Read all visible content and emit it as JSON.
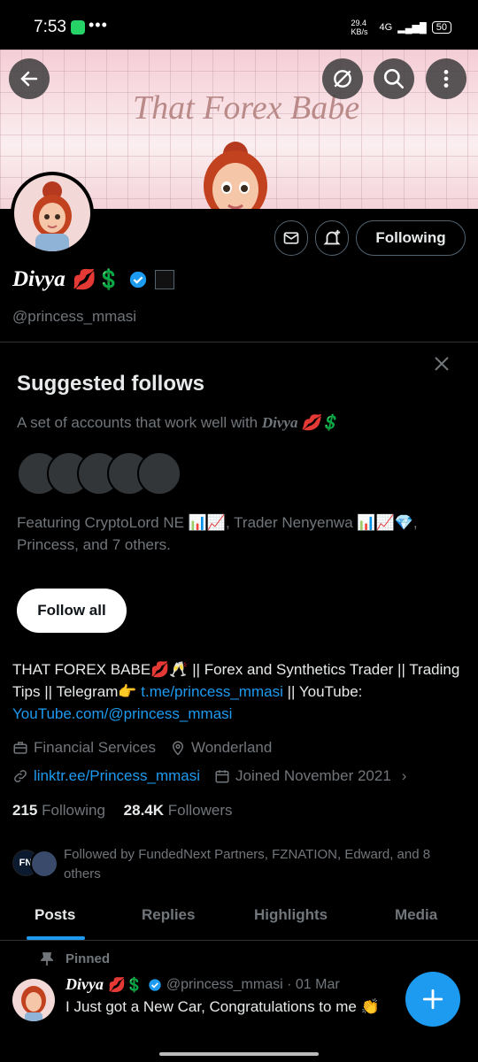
{
  "status_bar": {
    "time": "7:53",
    "dots": "•••",
    "net_speed": "29.4 KB/s",
    "network": "4G",
    "battery": "50"
  },
  "header": {
    "banner_title": "That Forex Babe"
  },
  "profile": {
    "name": "Divya",
    "name_emojis": "💋💲",
    "handle": "@princess_mmasi",
    "following_button": "Following"
  },
  "suggested": {
    "title": "Suggested follows",
    "subtitle_prefix": "A set of accounts that work well with ",
    "subtitle_name": "Divya 💋💲",
    "featuring": "Featuring CryptoLord NE 📊📈, Trader Nenyenwa 📊📈💎, Princess, and 7 others.",
    "follow_all": "Follow all"
  },
  "bio": {
    "text1": "THAT FOREX BABE💋🥂 || Forex and Synthetics Trader || Trading Tips || Telegram👉 ",
    "link1": "t.me/princess_mmasi",
    "text2": " || YouTube: ",
    "link2": "YouTube.com/@princess_mmasi"
  },
  "meta": {
    "category": "Financial Services",
    "location": "Wonderland",
    "website": "linktr.ee/Princess_mmasi",
    "joined": "Joined November 2021"
  },
  "stats": {
    "following_count": "215",
    "following_label": "Following",
    "followers_count": "28.4K",
    "followers_label": "Followers"
  },
  "followed_by": "Followed by FundedNext Partners, FZNATION, Edward, and 8 others",
  "followed_by_badge": "FN",
  "tabs": [
    "Posts",
    "Replies",
    "Highlights",
    "Media"
  ],
  "pinned_post": {
    "pinned_label": "Pinned",
    "name": "Divya",
    "name_emojis": "💋💲",
    "handle_date": "@princess_mmasi · 01 Mar",
    "text": "I Just got a New Car, Congratulations to me 👏"
  },
  "colors": {
    "accent": "#1d9bf0",
    "background": "#000000",
    "text": "#e7e9ea",
    "muted": "#71767b"
  },
  "icons": [
    "back-arrow-icon",
    "sync-off-icon",
    "search-icon",
    "more-vert-icon",
    "message-icon",
    "bell-plus-icon",
    "verified-icon",
    "briefcase-icon",
    "location-icon",
    "link-icon",
    "calendar-icon",
    "pin-icon",
    "plus-icon",
    "close-icon"
  ]
}
